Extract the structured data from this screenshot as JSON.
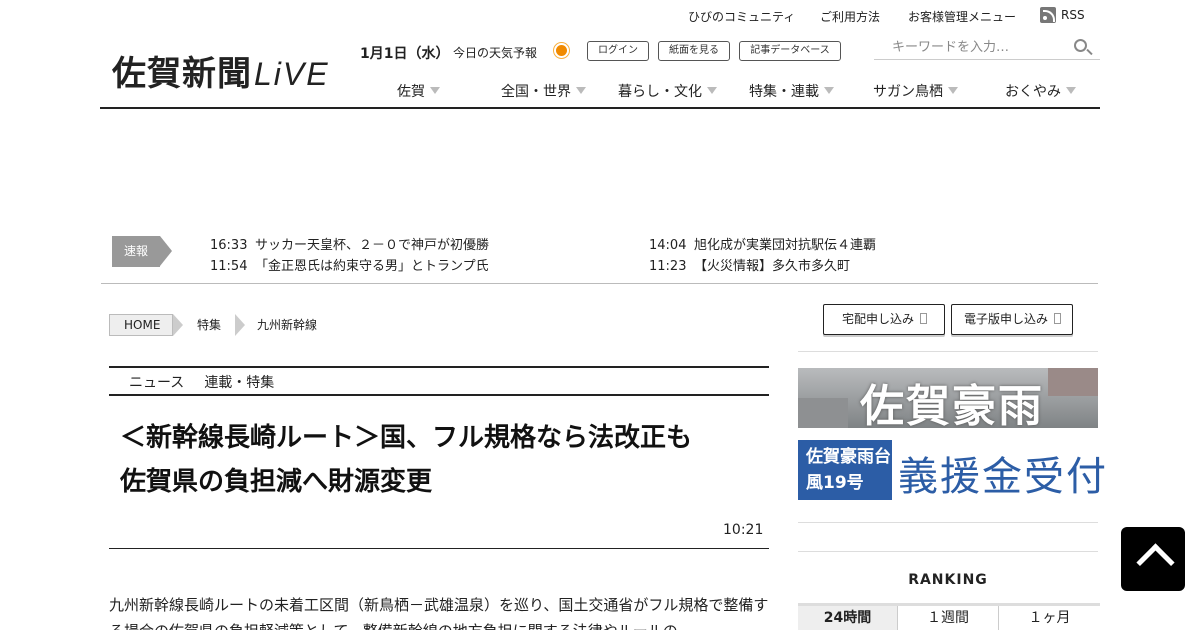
{
  "top_links": {
    "community": "ひびのコミュニティ",
    "usage": "ご利用方法",
    "customer_menu": "お客様管理メニュー",
    "rss": "RSS"
  },
  "logo": {
    "main": "佐賀新聞",
    "live": "LiVE"
  },
  "header": {
    "date": "1月1日（水）",
    "weather_label": "今日の天気予報",
    "login": "ログイン",
    "view_paper": "紙面を見る",
    "article_db": "記事データベース"
  },
  "search": {
    "placeholder": "キーワードを入力…"
  },
  "nav": [
    "佐賀",
    "全国・世界",
    "暮らし・文化",
    "特集・連載",
    "サガン鳥栖",
    "おくやみ"
  ],
  "breaking": {
    "label": "速報",
    "items": [
      {
        "time": "16:33",
        "text": "サッカー天皇杯、２－０で神戸が初優勝"
      },
      {
        "time": "11:54",
        "text": "「金正恩氏は約束守る男」とトランプ氏"
      },
      {
        "time": "14:04",
        "text": "旭化成が実業団対抗駅伝４連覇"
      },
      {
        "time": "11:23",
        "text": "【火災情報】多久市多久町"
      }
    ]
  },
  "breadcrumb": [
    "HOME",
    "特集",
    "九州新幹線"
  ],
  "categories": [
    "ニュース",
    "連載・特集"
  ],
  "article": {
    "headline": "＜新幹線長崎ルート＞国、フル規格なら法改正も　佐賀県の負担減へ財源変更",
    "time": "10:21",
    "body": "九州新幹線長崎ルートの未着工区間（新鳥栖－武雄温泉）を巡り、国土交通省がフル規格で整備する場合の佐賀県の負担軽減策として、整備新幹線の地方負担に関する法律やルールの"
  },
  "sidebar": {
    "delivery_button": "宅配申し込み",
    "digital_button": "電子版申し込み",
    "banner1_text": "佐賀豪雨",
    "banner2_label": "佐賀豪雨台風19号",
    "banner2_text": "義援金受付",
    "ranking_title": "RANKING",
    "ranking_tabs": [
      "24時間",
      "１週間",
      "１ヶ月"
    ]
  },
  "colors": {
    "accent_blue": "#2c5da6",
    "badge_gray": "#999999",
    "rule": "#222222"
  }
}
